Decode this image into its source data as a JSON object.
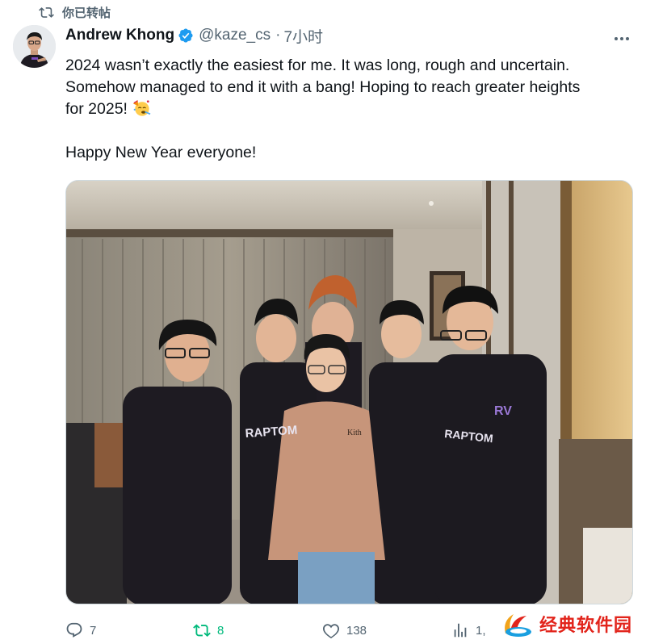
{
  "retweet": {
    "label": "你已转帖",
    "icon": "retweet-icon"
  },
  "author": {
    "name": "Andrew Khong",
    "handle": "@kaze_cs",
    "separator": "·",
    "time": "7小时",
    "verified_color": "#1d9bf0"
  },
  "tweet": {
    "lines": [
      "2024 wasn’t exactly the easiest for me. It was long, rough and uncertain.",
      "Somehow managed to end it with a bang! Hoping to reach greater heights",
      "for 2025!"
    ],
    "emoji": "party-face-emoji",
    "closing": "Happy New Year everyone!"
  },
  "photo": {
    "jersey_text": "RAPTOM",
    "jersey_logo": "RV",
    "hoodie_text": "Kith"
  },
  "actions": {
    "reply_count": "7",
    "retweet_count": "8",
    "like_count": "138",
    "views_count": "1,",
    "retweet_color": "#00ba7c"
  },
  "watermark": {
    "text": "经典软件园"
  }
}
